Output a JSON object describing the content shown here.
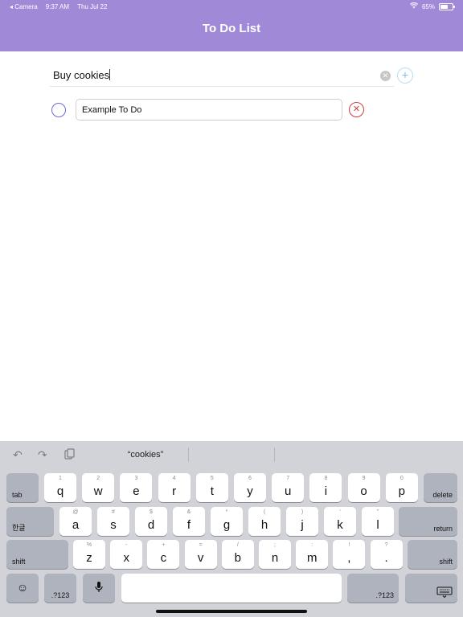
{
  "status_bar": {
    "back_app": "◂ Camera",
    "time": "9:37 AM",
    "date": "Thu Jul 22",
    "battery": "65%",
    "wifi_icon": "wifi-icon",
    "battery_level": 0.65
  },
  "nav": {
    "title": "To Do List"
  },
  "new_item": {
    "value": "Buy cookies",
    "clear_icon": "clear-icon",
    "add_label": "+"
  },
  "todos": [
    {
      "text": "Example To Do",
      "completed": false
    }
  ],
  "keyboard": {
    "suggestion": "“cookies”",
    "row1": [
      {
        "main": "q",
        "alt": "1"
      },
      {
        "main": "w",
        "alt": "2"
      },
      {
        "main": "e",
        "alt": "3"
      },
      {
        "main": "r",
        "alt": "4"
      },
      {
        "main": "t",
        "alt": "5"
      },
      {
        "main": "y",
        "alt": "6"
      },
      {
        "main": "u",
        "alt": "7"
      },
      {
        "main": "i",
        "alt": "8"
      },
      {
        "main": "o",
        "alt": "9"
      },
      {
        "main": "p",
        "alt": "0"
      }
    ],
    "row2": [
      {
        "main": "a",
        "alt": "@"
      },
      {
        "main": "s",
        "alt": "#"
      },
      {
        "main": "d",
        "alt": "$"
      },
      {
        "main": "f",
        "alt": "&"
      },
      {
        "main": "g",
        "alt": "*"
      },
      {
        "main": "h",
        "alt": "("
      },
      {
        "main": "j",
        "alt": ")"
      },
      {
        "main": "k",
        "alt": "'"
      },
      {
        "main": "l",
        "alt": "\""
      }
    ],
    "row3": [
      {
        "main": "z",
        "alt": "%"
      },
      {
        "main": "x",
        "alt": "-"
      },
      {
        "main": "c",
        "alt": "+"
      },
      {
        "main": "v",
        "alt": "="
      },
      {
        "main": "b",
        "alt": "/"
      },
      {
        "main": "n",
        "alt": ";"
      },
      {
        "main": "m",
        "alt": ":"
      },
      {
        "main": ",",
        "alt": "!"
      },
      {
        "main": ".",
        "alt": "?"
      }
    ],
    "tab": "tab",
    "delete": "delete",
    "lang": "한글",
    "return": "return",
    "shift": "shift",
    "numbers": ".?123",
    "emoji_icon": "emoji-icon",
    "mic_icon": "mic-icon",
    "dismiss_icon": "keyboard-dismiss-icon"
  }
}
